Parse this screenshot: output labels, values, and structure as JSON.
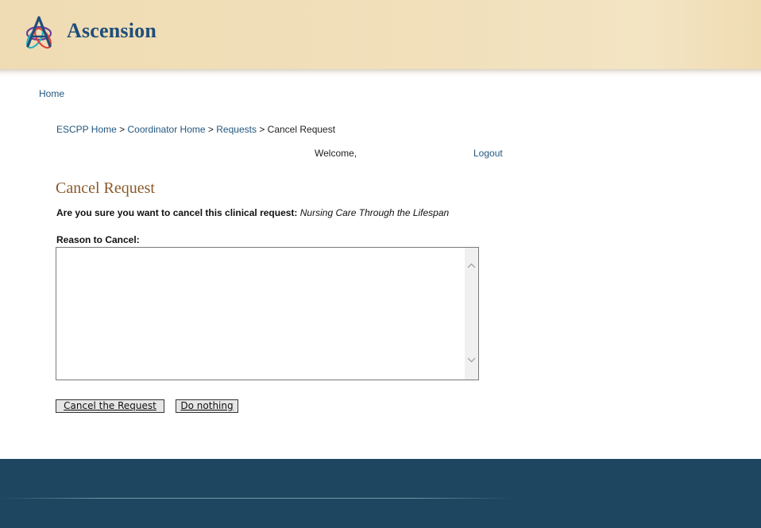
{
  "header": {
    "logo_text": "Ascension",
    "logo_icon": "ascension-logo-icon"
  },
  "nav": {
    "home": "Home"
  },
  "breadcrumb": {
    "items": [
      "ESCPP Home",
      "Coordinator Home",
      "Requests"
    ],
    "current": "Cancel Request",
    "separator": ">"
  },
  "user": {
    "welcome": "Welcome,",
    "logout": "Logout"
  },
  "main": {
    "title": "Cancel Request",
    "confirm_question": "Are you sure you want to cancel this clinical request:",
    "course_name": "Nursing Care Through the Lifespan",
    "reason_label": "Reason to Cancel:",
    "reason_value": "",
    "cancel_button": "Cancel the Request",
    "do_nothing_button": "Do nothing"
  },
  "colors": {
    "header_bg": "#efdcb4",
    "brand_blue": "#1f4e79",
    "link": "#23577f",
    "title_brown": "#8a5a2b",
    "footer_bg": "#1f4660"
  }
}
